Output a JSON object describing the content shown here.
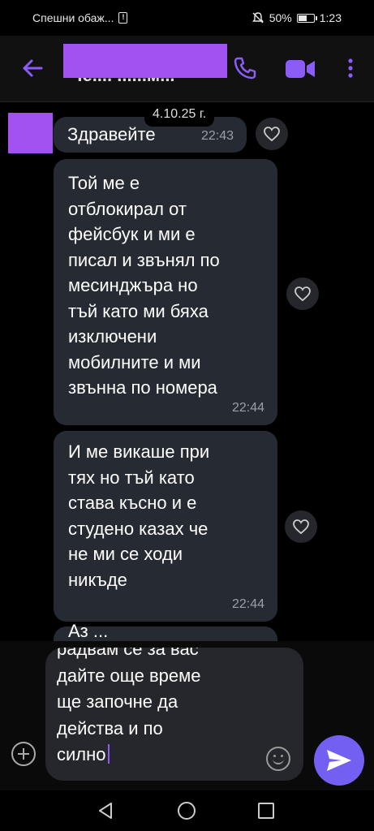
{
  "status_bar": {
    "left_text": "Спешни обаж...",
    "battery": "50%",
    "time": "1:23"
  },
  "header": {
    "title": "Че.... ......м..."
  },
  "chat": {
    "date": "4.10.25 г.",
    "messages": [
      {
        "text": "Здравейте",
        "time": "22:43"
      },
      {
        "text": "Той ме е\nотблокирал от\nфейсбук и ми е\nписал и  звънял по\nмесинджъра но\nтъй като ми бяха\nизключени\nмобилните и ми\nзвънна по номера",
        "time": "22:44"
      },
      {
        "text": "И ме викаше при\nтях но тъй като\nстава късно и е\nстудено казах че\nне ми се ходи\nникъде",
        "time": "22:44"
      },
      {
        "text": "Аз ...",
        "time": ""
      }
    ]
  },
  "composer": {
    "value": "радвам се за вас\nдайте още време\nще започне да\nдейства и по\nсилно"
  },
  "colors": {
    "accent": "#7360f2",
    "bubble": "#262a33",
    "redaction": "#a152f0"
  }
}
